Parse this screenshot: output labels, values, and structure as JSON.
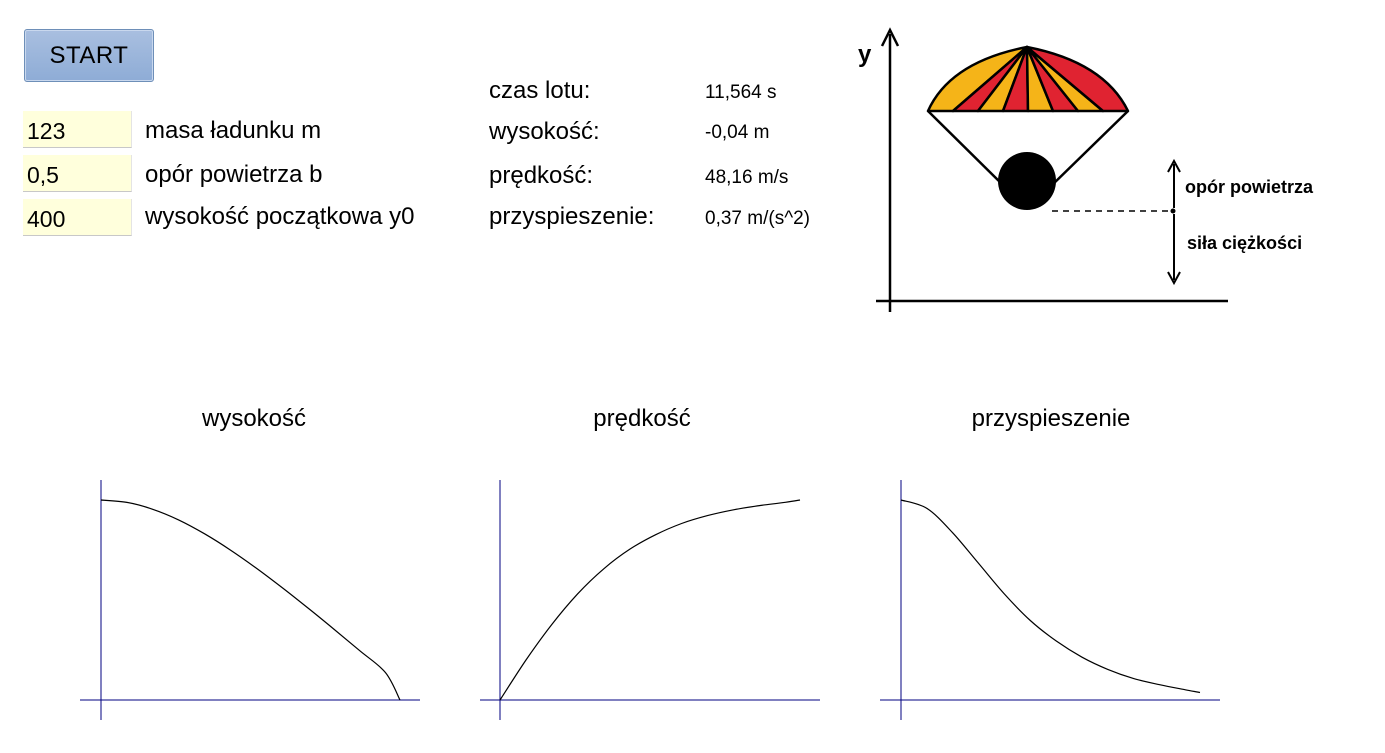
{
  "controls": {
    "start_label": "START"
  },
  "inputs": [
    {
      "value": "123",
      "label": "masa ładunku m"
    },
    {
      "value": "0,5",
      "label": "opór powietrza b"
    },
    {
      "value": "400",
      "label": "wysokość początkowa y0"
    }
  ],
  "readouts": [
    {
      "label": "czas lotu:",
      "value": "11,564 s"
    },
    {
      "label": "wysokość:",
      "value": "-0,04 m"
    },
    {
      "label": "prędkość:",
      "value": "48,16 m/s"
    },
    {
      "label": "przyspieszenie:",
      "value": "0,37 m/(s^2)"
    }
  ],
  "diagram": {
    "axis_label": "y",
    "force_up_label": "opór powietrza",
    "force_down_label": "siła ciężkości",
    "canopy_colors": [
      "#f5b418",
      "#e02331"
    ]
  },
  "chart_data": [
    {
      "type": "line",
      "title": "wysokość",
      "xlabel": "",
      "ylabel": "",
      "x": [
        0,
        1,
        2,
        3,
        4,
        5,
        6,
        7,
        8,
        9,
        10,
        11,
        11.564
      ],
      "y": [
        400,
        395.2,
        381.5,
        360.2,
        332.6,
        300.1,
        263.9,
        225.0,
        184.2,
        142.0,
        98.8,
        54.9,
        0
      ]
    },
    {
      "type": "line",
      "title": "prędkość",
      "xlabel": "",
      "ylabel": "",
      "x": [
        0,
        1,
        2,
        3,
        4,
        5,
        6,
        7,
        8,
        9,
        10,
        11,
        11.564
      ],
      "y": [
        0,
        9.6,
        18.2,
        25.6,
        31.6,
        36.3,
        39.8,
        42.5,
        44.4,
        45.8,
        46.8,
        47.6,
        48.16
      ]
    },
    {
      "type": "line",
      "title": "przyspieszenie",
      "xlabel": "",
      "ylabel": "",
      "x": [
        0,
        1,
        2,
        3,
        4,
        5,
        6,
        7,
        8,
        9,
        10,
        11,
        11.564
      ],
      "y": [
        9.81,
        9.4,
        8.2,
        6.7,
        5.2,
        3.9,
        2.9,
        2.1,
        1.5,
        1.05,
        0.75,
        0.5,
        0.37
      ]
    }
  ]
}
